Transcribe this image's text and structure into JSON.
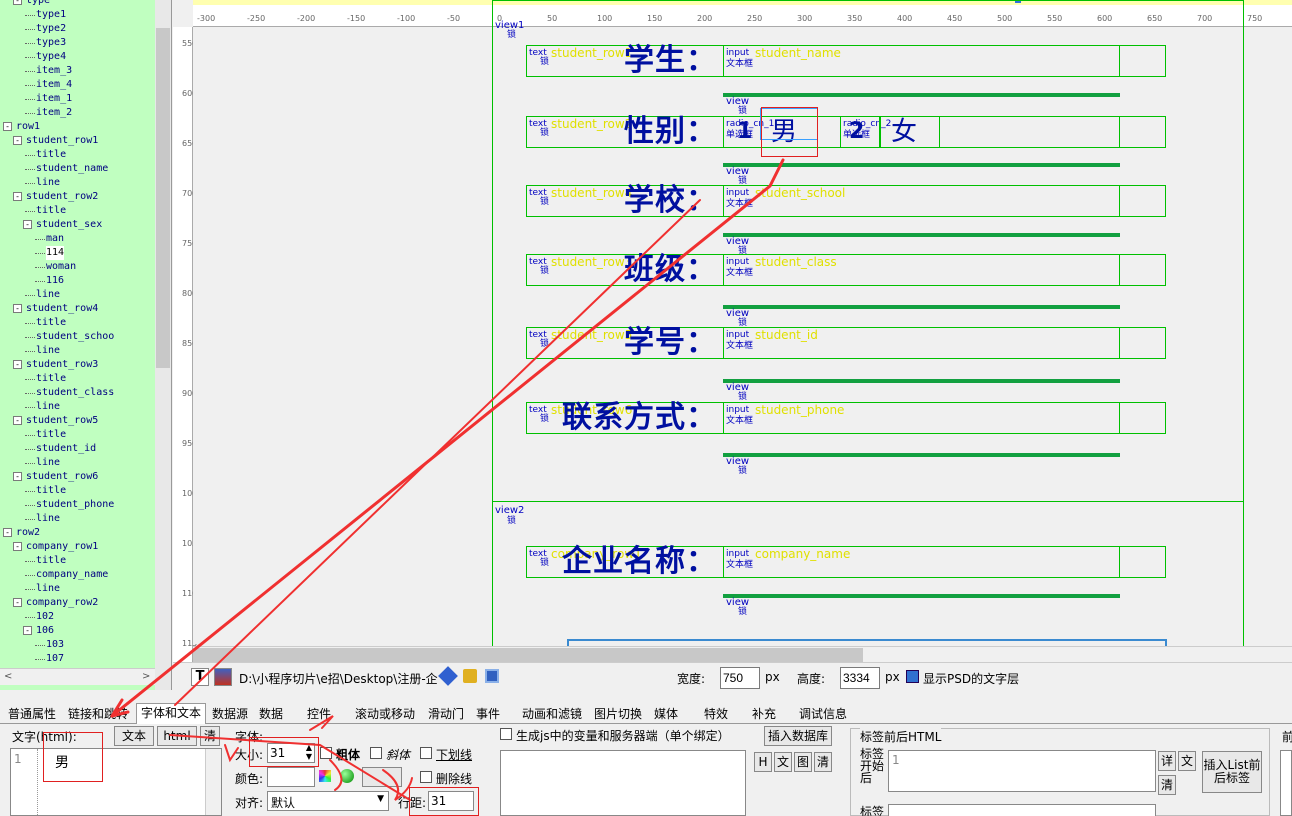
{
  "tree": {
    "items": [
      {
        "label": "type",
        "toggle": "-"
      },
      {
        "label": "type1"
      },
      {
        "label": "type2"
      },
      {
        "label": "type3"
      },
      {
        "label": "type4"
      },
      {
        "label": "item_3"
      },
      {
        "label": "item_4"
      },
      {
        "label": "item_1"
      },
      {
        "label": "item_2"
      },
      {
        "label": "row1",
        "toggle": "-"
      },
      {
        "label": "student_row1",
        "toggle": "-"
      },
      {
        "label": "title"
      },
      {
        "label": "student_name"
      },
      {
        "label": "line"
      },
      {
        "label": "student_row2",
        "toggle": "-"
      },
      {
        "label": "title"
      },
      {
        "label": "student_sex",
        "toggle": "-"
      },
      {
        "label": "man"
      },
      {
        "label": "114",
        "selected": true
      },
      {
        "label": "woman"
      },
      {
        "label": "116"
      },
      {
        "label": "line"
      },
      {
        "label": "student_row4",
        "toggle": "-"
      },
      {
        "label": "title"
      },
      {
        "label": "student_schoo"
      },
      {
        "label": "line"
      },
      {
        "label": "student_row3",
        "toggle": "-"
      },
      {
        "label": "title"
      },
      {
        "label": "student_class"
      },
      {
        "label": "line"
      },
      {
        "label": "student_row5",
        "toggle": "-"
      },
      {
        "label": "title"
      },
      {
        "label": "student_id"
      },
      {
        "label": "line"
      },
      {
        "label": "student_row6",
        "toggle": "-"
      },
      {
        "label": "title"
      },
      {
        "label": "student_phone"
      },
      {
        "label": "line"
      },
      {
        "label": "row2",
        "toggle": "-"
      },
      {
        "label": "company_row1",
        "toggle": "-"
      },
      {
        "label": "title"
      },
      {
        "label": "company_name"
      },
      {
        "label": "line"
      },
      {
        "label": "company_row2",
        "toggle": "-"
      },
      {
        "label": "102"
      },
      {
        "label": "106",
        "toggle": "-"
      },
      {
        "label": "103"
      },
      {
        "label": "107"
      }
    ],
    "scroll_left": "<",
    "scroll_right": ">"
  },
  "ruler": {
    "top_ticks": [
      "-300",
      "-250",
      "-200",
      "-150",
      "-100",
      "-50",
      "0",
      "50",
      "100",
      "150",
      "200",
      "250",
      "300",
      "350",
      "400",
      "450",
      "500",
      "550",
      "600",
      "650",
      "700",
      "750"
    ],
    "left_ticks": [
      "550",
      "600",
      "650",
      "700",
      "750",
      "800",
      "850",
      "900",
      "950",
      "1000",
      "1050",
      "1100",
      "115"
    ]
  },
  "canvas": {
    "view1": "view1",
    "view2": "view2",
    "lock": "锁",
    "view": "view",
    "text": "text",
    "input": "input",
    "textbox": "文本框",
    "radio": "radio",
    "rows": [
      {
        "name": "student_row1",
        "title": "学生：",
        "input": "student_name"
      },
      {
        "name": "student_row2",
        "title": "性别：",
        "radio1": "男",
        "radio2": "女",
        "radio1_name": "radio_cn_1",
        "radio2_name": "radio_cn_2",
        "radio1_label": "单选框",
        "radio2_label": "单选框",
        "radio1_prefix": "1",
        "radio2_prefix": "2"
      },
      {
        "name": "student_row4",
        "title": "学校：",
        "input": "student_school"
      },
      {
        "name": "student_row3",
        "title": "班级：",
        "input": "student_class"
      },
      {
        "name": "student_row5",
        "title": "学号：",
        "input": "student_id"
      },
      {
        "name": "student_row6",
        "title": "联系方式：",
        "input": "student_phone"
      },
      {
        "name": "company_row1",
        "title": "企业名称：",
        "input": "company_name"
      }
    ]
  },
  "pathbar": {
    "path": "D:\\小程序切片\\e招\\Desktop\\注册-企",
    "width_label": "宽度:",
    "width": "750",
    "px": "px",
    "height_label": "高度:",
    "height": "3334",
    "psd_label": "显示PSD的文字层"
  },
  "tabs": [
    "普通属性",
    "链接和跳转",
    "字体和文本",
    "数据源",
    "数据",
    "控件",
    "滚动或移动",
    "滑动门",
    "事件",
    "动画和滤镜",
    "图片切换",
    "媒体",
    "特效",
    "补充",
    "调试信息"
  ],
  "panel": {
    "text_label": "文字(html):",
    "text_btn": "文本",
    "html_btn": "html",
    "clear_btn": "清",
    "line_no": "1",
    "text_value": "男",
    "font_label": "字体:",
    "size_label": "大小:",
    "size_value": "31",
    "bold_label": "粗体",
    "italic_label": "斜体",
    "underline_label": "下划线",
    "color_label": "颜色:",
    "strike_label": "删除线",
    "align_label": "对齐:",
    "align_value": "默认",
    "line_height_label": "行距:",
    "line_height_value": "31",
    "js_label": "生成js中的变量和服务器端（单个绑定）",
    "insert_db": "插入数据库",
    "small_btns": [
      "H",
      "文",
      "图",
      "清"
    ],
    "tag_html_label": "标签前后HTML",
    "tag_start_label": "标签开始后",
    "tag_line": "1",
    "detail_btn": "详",
    "wen_btn": "文",
    "clear2_btn": "清",
    "insert_list": "插入List前后标签",
    "tag2_label": "标签",
    "extra_label": "前"
  }
}
